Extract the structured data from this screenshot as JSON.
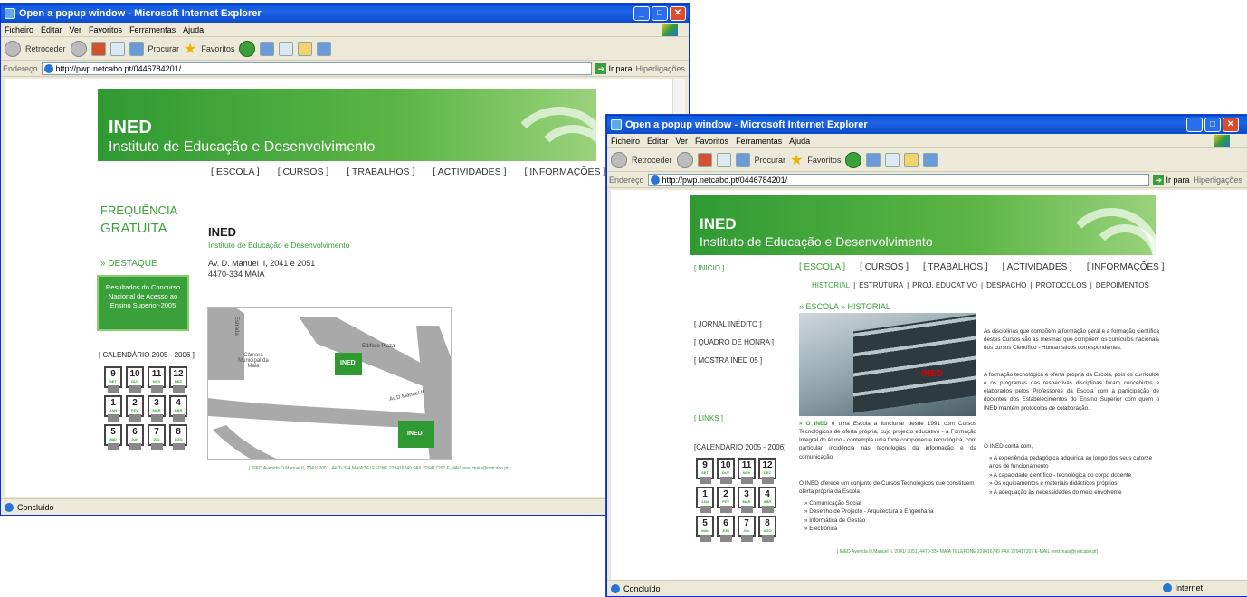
{
  "window": {
    "title": "Open a popup window - Microsoft Internet Explorer",
    "menu": [
      "Ficheiro",
      "Editar",
      "Ver",
      "Favoritos",
      "Ferramentas",
      "Ajuda"
    ],
    "toolbar": {
      "back": "Retroceder",
      "search": "Procurar",
      "favorites": "Favoritos"
    },
    "address_label": "Endereço",
    "url": "http://pwp.netcabo.pt/0446784201/",
    "go": "Ir para",
    "links": "Hiperligações",
    "status_left": "Concluído",
    "status_right": "Internet"
  },
  "page1": {
    "banner_title": "INED",
    "banner_sub": "Instituto de Educação e Desenvolvimento",
    "nav": [
      "[ ESCOLA ]",
      "[ CURSOS ]",
      "[ TRABALHOS ]",
      "[ ACTIVIDADES ]",
      "[ INFORMAÇÕES ]"
    ],
    "freq_line1": "FREQUÊNCIA",
    "freq_line2": "GRATUITA",
    "destaque": "» DESTAQUE",
    "highlight": "Resultados do Concurso Nacional de Acesso ao Ensino Superior-2005",
    "calendar": "[ CALENDÁRIO 2005 - 2006 ]",
    "org_title": "INED",
    "org_sub": "Instituto de Educação e Desenvolvimento",
    "address1": "Av. D. Manuel II, 2041 e 2051",
    "address2": "4470-334 MAIA",
    "map": {
      "street_left": "Estrada",
      "camara": "Câmara Municipal da Maia",
      "edificio": "Edifício Plaza",
      "avenida": "Av.D.Manuel II",
      "ined1": "INED",
      "ined2": "INED"
    },
    "footer": "[ INED Avenida D.Manuel II, 2041/ 2051, 4470-334 MAIA   TELEFONE 229416749   FAX 229417207   E-MAIL ined.maia@netcabo.pt]"
  },
  "page2": {
    "banner_title": "INED",
    "banner_sub": "Instituto de Educação e Desenvolvimento",
    "inicio": "[ INICIO ]",
    "nav": [
      "[ ESCOLA ]",
      "[ CURSOS ]",
      "[ TRABALHOS ]",
      "[ ACTIVIDADES ]",
      "[ INFORMAÇÕES ]"
    ],
    "subnav": [
      "HISTORIAL",
      "ESTRUTURA",
      "PROJ. EDUCATIVO",
      "DESPACHO",
      "PROTOCOLOS",
      "DEPOIMENTOS"
    ],
    "breadcrumb": "» ESCOLA » HISTORIAL",
    "side_links": [
      "[ JORNAL INÉDITO ]",
      "[ QUADRO DE HONRA ]",
      "[ MOSTRA INED 05 ]"
    ],
    "links": "[ LINKS ]",
    "calendar": "[CALENDÁRIO 2005 - 2006]",
    "photo_text": "INED",
    "para1_lead": "» O INED",
    "para1": "é uma Escola a funcionar desde 1991 com Cursos Tecnológicos de oferta própria, cujo projecto educativo - a Formação Integral do Aluno - contempla uma forte componente tecnológica, com particular incidência nas tecnologias da informação e da comunicação.",
    "para2": "O INED oferece um conjunto de Cursos Tecnológicos que constituem oferta própria da Escola",
    "courses": [
      "» Comunicação Social",
      "» Desenho de Projecto - Arquitectura e Engenharia",
      "» Informática de Gestão",
      "» Electrónica"
    ],
    "right_p1": "As disciplinas que compõem a formação geral e a formação científica destes Cursos são as mesmas que compõem os currículos nacionais dos cursos Científico - Humanísticos correspondentes.",
    "right_p2": "A formação tecnológica é oferta própria da Escola, pois os currículos e os programas das respectivas disciplinas foram concebidos e elaborados pelos Professores da Escola com a participação de docentes dos Estabelecimentos do Ensino Superior com quem o INED mantém protocolos de colaboração.",
    "right_p3": "O INED conta com,",
    "right_list": [
      "» A experiência pedagógica adquirida ao longo dos seus catorze anos de funcionamento",
      "» A capacidade científico - tecnológica do corpo docente",
      "» Os equipamentos e materiais didácticos próprios",
      "» A adequação às necessidades do meio envolvente"
    ],
    "footer": "[ INED Avenida D.Manuel II, 2041/ 2051, 4470-334 MAIA   TELEFONE 229416749   FAX 229417207   E-MAIL ined.maia@netcabo.pt]"
  },
  "calendar_tiles": [
    {
      "n": "9",
      "m": "SET"
    },
    {
      "n": "10",
      "m": "OUT"
    },
    {
      "n": "11",
      "m": "NOV"
    },
    {
      "n": "12",
      "m": "DEZ"
    },
    {
      "n": "1",
      "m": "JAN"
    },
    {
      "n": "2",
      "m": "FEV"
    },
    {
      "n": "3",
      "m": "MAR"
    },
    {
      "n": "4",
      "m": "ABR"
    },
    {
      "n": "5",
      "m": "MAI"
    },
    {
      "n": "6",
      "m": "JUN"
    },
    {
      "n": "7",
      "m": "JUL"
    },
    {
      "n": "8",
      "m": "AGO"
    }
  ],
  "colors": {
    "accent": "#3aa13a",
    "titlebar": "#0a5ad7"
  }
}
